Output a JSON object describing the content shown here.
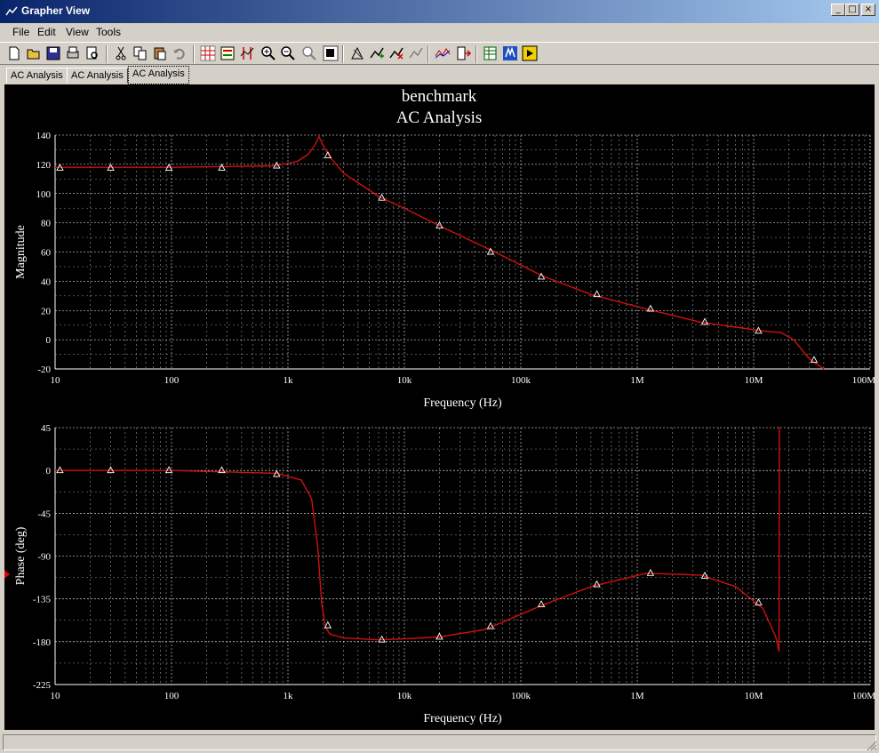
{
  "window": {
    "title": "Grapher View"
  },
  "menu": {
    "file": "File",
    "edit": "Edit",
    "view": "View",
    "tools": "Tools"
  },
  "toolbar": [
    "new-icon",
    "open-icon",
    "save-icon",
    "print-icon",
    "print-preview-icon",
    "cut-icon",
    "copy-icon",
    "paste-icon",
    "undo-icon",
    "grid-icon",
    "legend-icon",
    "cursors-icon",
    "zoom-in-icon",
    "zoom-out-icon",
    "zoom-full-icon",
    "reverse-colors-icon",
    "select-marks-icon",
    "add-trace-icon",
    "remove-trace-icon",
    "properties-icon",
    "overlay-icon",
    "export-icon",
    "excel-export-icon",
    "mathcad-icon",
    "labview-icon"
  ],
  "tabs": [
    "AC Analysis",
    "AC Analysis",
    "AC Analysis"
  ],
  "active_tab": 2,
  "plot": {
    "title": "benchmark",
    "subtitle": "AC Analysis",
    "background": "#000000",
    "grid_color": "#ffffff",
    "trace_color": "#d01010"
  },
  "chart_data": [
    {
      "type": "line",
      "name": "magnitude",
      "ylabel": "Magnitude",
      "xlabel": "Frequency (Hz)",
      "x_scale": "log",
      "xlim": [
        10,
        100000000
      ],
      "ylim": [
        -20,
        140
      ],
      "yticks": [
        -20,
        0,
        20,
        40,
        60,
        80,
        100,
        120,
        140
      ],
      "xtick_labels": [
        "10",
        "100",
        "1k",
        "10k",
        "100k",
        "1M",
        "10M",
        "100M"
      ],
      "grid": true,
      "x": [
        10,
        100,
        800,
        1200,
        1500,
        1700,
        1850,
        2000,
        2300,
        3000,
        6000,
        10000,
        20000,
        60000,
        150000,
        400000,
        1200000,
        3500000,
        8000000,
        12000000,
        17000000,
        22000000,
        30000000,
        40000000
      ],
      "y": [
        118,
        118,
        119,
        122,
        127,
        133,
        139,
        133,
        125,
        114,
        98,
        90,
        78,
        60,
        44,
        31,
        21,
        12,
        8,
        6,
        5,
        0,
        -13,
        -20
      ],
      "markers_x": [
        11,
        30,
        95,
        270,
        800,
        2200,
        6400,
        20000,
        55000,
        150000,
        450000,
        1300000,
        3800000,
        11000000,
        33000000
      ],
      "markers_y": [
        117.5,
        117.5,
        117.5,
        117.5,
        119,
        126,
        97,
        78,
        60,
        43,
        31,
        21,
        12,
        6,
        -14
      ]
    },
    {
      "type": "line",
      "name": "phase",
      "ylabel": "Phase (deg)",
      "xlabel": "Frequency (Hz)",
      "x_scale": "log",
      "xlim": [
        10,
        100000000
      ],
      "ylim": [
        -225,
        45
      ],
      "yticks": [
        -225,
        -180,
        -135,
        -90,
        -45,
        0,
        45
      ],
      "xtick_labels": [
        "10",
        "100",
        "1k",
        "10k",
        "100k",
        "1M",
        "10M",
        "100M"
      ],
      "grid": true,
      "x": [
        10,
        100,
        800,
        1300,
        1600,
        1800,
        1950,
        2100,
        2300,
        3000,
        6000,
        10000,
        20000,
        50000,
        150000,
        400000,
        1200000,
        3500000,
        7000000,
        12000000,
        15500000,
        16500000,
        16600000,
        16800000
      ],
      "y": [
        0,
        0,
        -3,
        -10,
        -30,
        -80,
        -140,
        -165,
        -172,
        -176,
        -178,
        -177,
        -175,
        -167,
        -142,
        -122,
        -108,
        -110,
        -122,
        -145,
        -175,
        -190,
        45,
        45
      ],
      "markers_x": [
        11,
        30,
        95,
        270,
        800,
        2200,
        6400,
        20000,
        55000,
        150000,
        450000,
        1300000,
        3800000,
        11000000
      ],
      "markers_y": [
        0,
        0,
        0,
        0,
        -4,
        -163,
        -178,
        -175,
        -164,
        -141,
        -120,
        -108,
        -111,
        -139
      ]
    }
  ]
}
